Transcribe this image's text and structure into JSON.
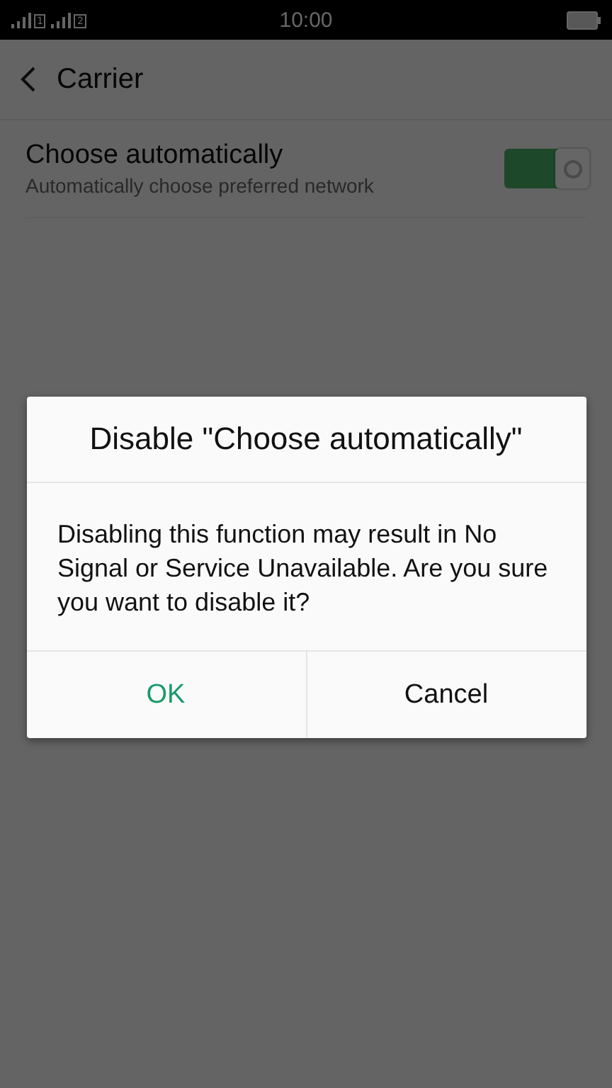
{
  "status_bar": {
    "sim_labels": [
      "1",
      "2"
    ],
    "time": "10:00"
  },
  "header": {
    "title": "Carrier"
  },
  "settings": [
    {
      "title": "Choose automatically",
      "subtitle": "Automatically choose preferred network",
      "on": true
    }
  ],
  "dialog": {
    "title": "Disable \"Choose automatically\"",
    "message": "Disabling this function may result in No Signal or Service Unavailable. Are you sure you want to disable it?",
    "buttons": [
      {
        "label": "OK",
        "kind": "primary"
      },
      {
        "label": "Cancel",
        "kind": "default"
      }
    ]
  }
}
